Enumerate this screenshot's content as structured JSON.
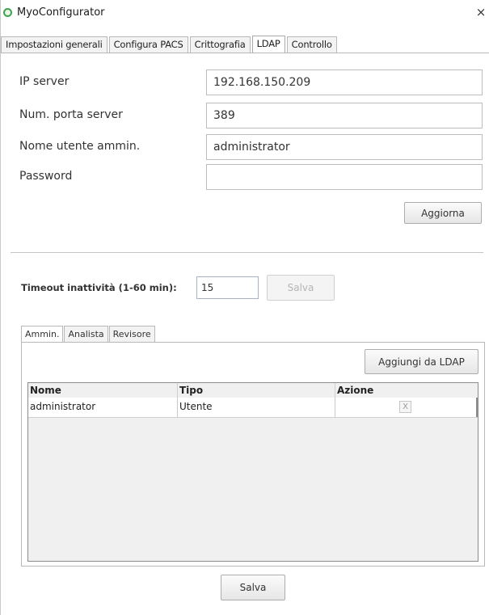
{
  "window": {
    "title": "MyoConfigurator",
    "close_symbol": "×"
  },
  "main_tabs": [
    {
      "label": "Impostazioni generali",
      "active": false
    },
    {
      "label": "Configura PACS",
      "active": false
    },
    {
      "label": "Crittografia",
      "active": false
    },
    {
      "label": "LDAP",
      "active": true
    },
    {
      "label": "Controllo",
      "active": false
    }
  ],
  "ldap": {
    "ip_label": "IP server",
    "ip_value": "192.168.150.209",
    "port_label": "Num. porta server",
    "port_value": "389",
    "admin_user_label": "Nome utente ammin.",
    "admin_user_value": "administrator",
    "password_label": "Password",
    "password_value": "",
    "update_button": "Aggiorna"
  },
  "timeout": {
    "label": "Timeout inattività (1-60 min):",
    "value": "15",
    "save_button": "Salva"
  },
  "role_tabs": [
    {
      "label": "Ammin.",
      "active": true
    },
    {
      "label": "Analista",
      "active": false
    },
    {
      "label": "Revisore",
      "active": false
    }
  ],
  "role_panel": {
    "add_button": "Aggiungi da LDAP",
    "columns": [
      "Nome",
      "Tipo",
      "Azione"
    ],
    "rows": [
      {
        "name": "administrator",
        "type": "Utente",
        "action_symbol": "X"
      }
    ]
  },
  "footer": {
    "save_button": "Salva"
  },
  "icons": {
    "app": "app-logo-icon",
    "close": "close-icon",
    "row_delete": "delete-x-icon"
  }
}
